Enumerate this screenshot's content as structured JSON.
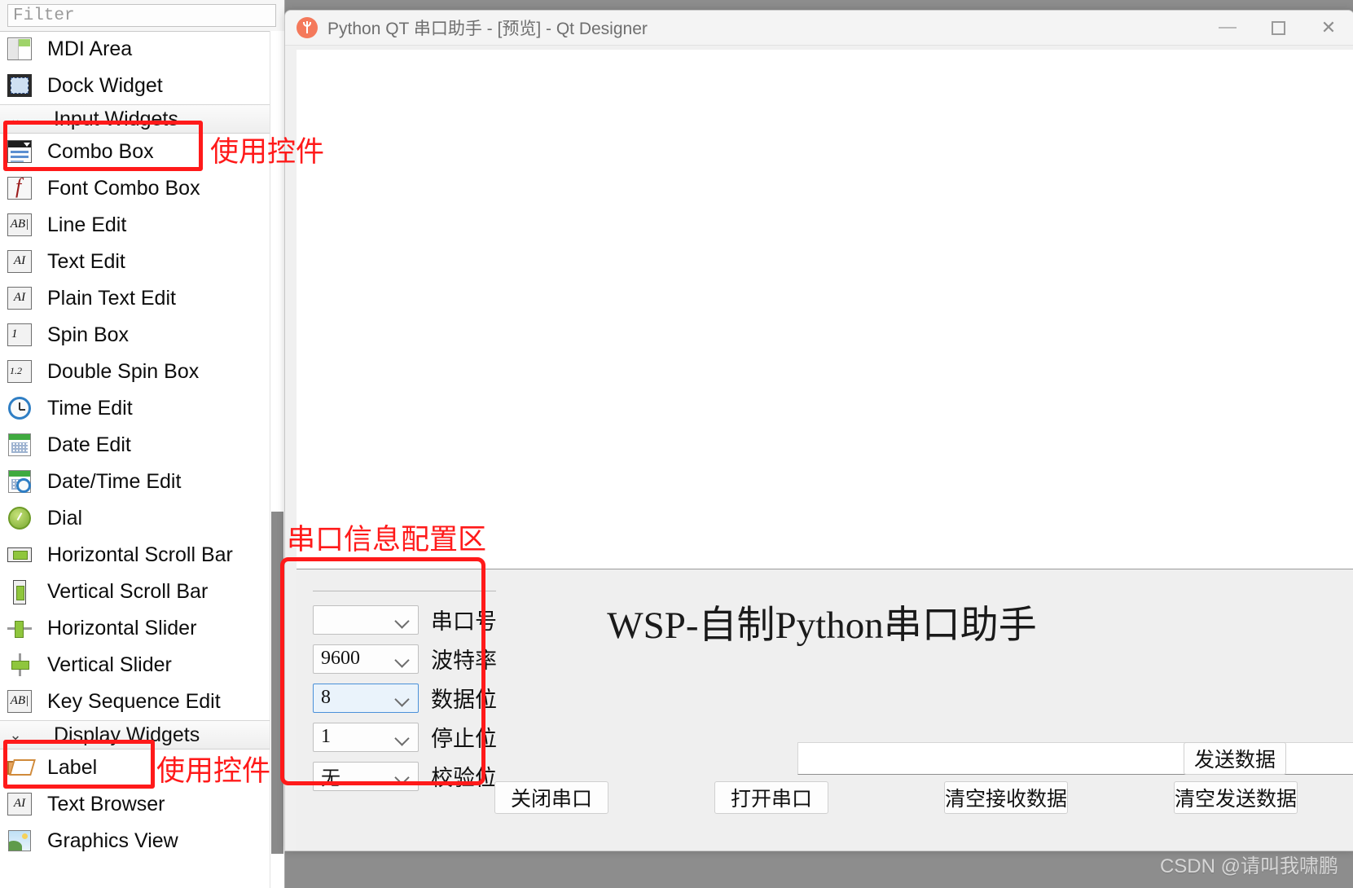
{
  "widget_box": {
    "filter_placeholder": "Filter",
    "scrollbar": "vertical-scrollbar",
    "items": [
      {
        "label": "MDI Area",
        "icon": "mdi-area-icon",
        "type": "item"
      },
      {
        "label": "Dock Widget",
        "icon": "dock-widget-icon",
        "type": "item"
      },
      {
        "label": "Input Widgets",
        "icon": "chevron-down-icon",
        "type": "group"
      },
      {
        "label": "Combo Box",
        "icon": "combo-box-icon",
        "type": "item",
        "selected": true
      },
      {
        "label": "Font Combo Box",
        "icon": "font-combo-box-icon",
        "type": "item"
      },
      {
        "label": "Line Edit",
        "icon": "line-edit-icon",
        "type": "item"
      },
      {
        "label": "Text Edit",
        "icon": "text-edit-icon",
        "type": "item"
      },
      {
        "label": "Plain Text Edit",
        "icon": "plain-text-edit-icon",
        "type": "item"
      },
      {
        "label": "Spin Box",
        "icon": "spin-box-icon",
        "type": "item"
      },
      {
        "label": "Double Spin Box",
        "icon": "double-spin-box-icon",
        "type": "item"
      },
      {
        "label": "Time Edit",
        "icon": "time-edit-icon",
        "type": "item"
      },
      {
        "label": "Date Edit",
        "icon": "date-edit-icon",
        "type": "item"
      },
      {
        "label": "Date/Time Edit",
        "icon": "date-time-edit-icon",
        "type": "item"
      },
      {
        "label": "Dial",
        "icon": "dial-icon",
        "type": "item"
      },
      {
        "label": "Horizontal Scroll Bar",
        "icon": "horizontal-scroll-bar-icon",
        "type": "item"
      },
      {
        "label": "Vertical Scroll Bar",
        "icon": "vertical-scroll-bar-icon",
        "type": "item"
      },
      {
        "label": "Horizontal Slider",
        "icon": "horizontal-slider-icon",
        "type": "item"
      },
      {
        "label": "Vertical Slider",
        "icon": "vertical-slider-icon",
        "type": "item"
      },
      {
        "label": "Key Sequence Edit",
        "icon": "key-sequence-edit-icon",
        "type": "item"
      },
      {
        "label": "Display Widgets",
        "icon": "chevron-down-icon",
        "type": "group"
      },
      {
        "label": "Label",
        "icon": "label-icon",
        "type": "item",
        "selected": true
      },
      {
        "label": "Text Browser",
        "icon": "text-browser-icon",
        "type": "item"
      },
      {
        "label": "Graphics View",
        "icon": "graphics-view-icon",
        "type": "item"
      }
    ],
    "icon_glyphs": {
      "line_edit": "AB|",
      "text_edit": "AI",
      "plain_text_edit": "AI",
      "spin_box": "1",
      "double_spin_box": "1.2",
      "key_sequence_edit": "AB|",
      "text_browser": "AI"
    }
  },
  "annotations": [
    {
      "id": "combo-box-callout",
      "text": "使用控件",
      "color": "#ff1a1a"
    },
    {
      "id": "label-callout",
      "text": "使用控件",
      "color": "#ff1a1a"
    },
    {
      "id": "config-area-callout",
      "text": "串口信息配置区",
      "color": "#ff1a1a"
    }
  ],
  "qt_window": {
    "title": "Python QT 串口助手 - [预览] - Qt Designer",
    "icon": "usb-serial-icon",
    "controls": {
      "minimize": "–",
      "maximize": "□",
      "close": "✕"
    }
  },
  "preview": {
    "heading": "WSP-自制Python串口助手",
    "serial_config": {
      "rows": [
        {
          "value": "",
          "label": "串口号",
          "focused": false
        },
        {
          "value": "9600",
          "label": "波特率",
          "focused": false
        },
        {
          "value": "8",
          "label": "数据位",
          "focused": true
        },
        {
          "value": "1",
          "label": "停止位",
          "focused": false
        },
        {
          "value": "无",
          "label": "校验位",
          "focused": false
        }
      ]
    },
    "send_input": {
      "value": "",
      "placeholder": ""
    },
    "buttons": {
      "send": "发送数据",
      "close_port": "关闭串口",
      "open_port": "打开串口",
      "clear_recv": "清空接收数据",
      "clear_send": "清空发送数据"
    }
  },
  "watermark": "CSDN @请叫我啸鹏"
}
